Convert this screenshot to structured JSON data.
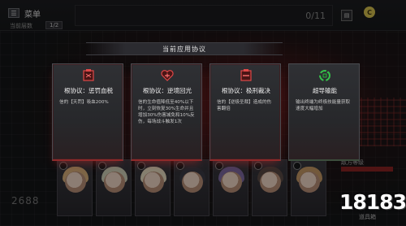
{
  "topbar": {
    "menu_label": "菜单",
    "menu_icon": "menu-icon",
    "floor_label": "当前层数",
    "floor_value": "1/2",
    "counter": "0/11",
    "coin_icon": "coin-icon",
    "coin_symbol": "C"
  },
  "background": {
    "left_number": "2688",
    "side_label": "敌方等级",
    "items_label": "道具箱"
  },
  "dialog": {
    "title": "当前应用协议",
    "cards": [
      {
        "title": "根协议：惩罚血税",
        "desc": "信的【天罚】吸血200%",
        "icon": "red-cube-icon",
        "accent": "#c0373a"
      },
      {
        "title": "根协议：逆境回光",
        "desc": "信的生命值降低至40%以下时，立刻恢复30%生命并且增加30%伤害减免和10%反伤，每场战斗触发1次",
        "icon": "red-heart-icon",
        "accent": "#c0373a"
      },
      {
        "title": "根协议：极刑裁决",
        "desc": "信的【逆极圣裁】造成的伤害翻倍",
        "icon": "red-cube-icon",
        "accent": "#c0373a"
      },
      {
        "title": "超导输能",
        "desc": "输出终端为终极技能量获取速度大幅增加",
        "icon": "green-recycle-icon",
        "accent": "#35c24a"
      }
    ]
  },
  "characters": [
    {
      "name": "char-1",
      "hair": "#d9b07a"
    },
    {
      "name": "char-2",
      "hair": "#cfd0b8"
    },
    {
      "name": "char-3",
      "hair": "#e7dcc2"
    },
    {
      "name": "char-4",
      "hair": "#3c3b45"
    },
    {
      "name": "char-5",
      "hair": "#7f6aa3"
    },
    {
      "name": "char-6",
      "hair": "#5a4a46"
    },
    {
      "name": "char-7",
      "hair": "#c79a66"
    }
  ],
  "watermark": "18183"
}
